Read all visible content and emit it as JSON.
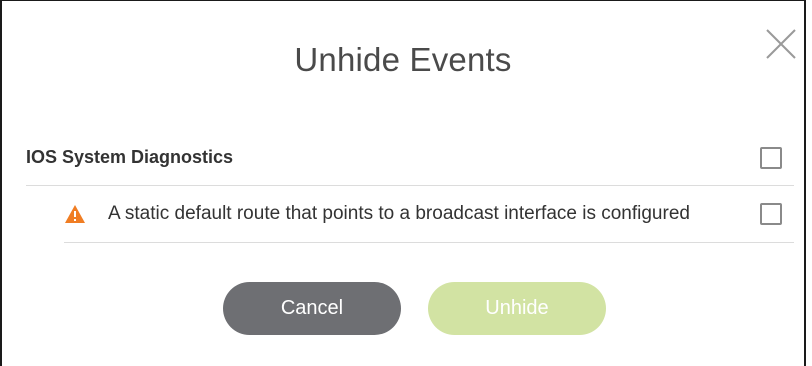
{
  "dialog": {
    "title": "Unhide Events",
    "close_icon": "close-icon"
  },
  "section": {
    "title": "IOS System Diagnostics",
    "checked": false
  },
  "events": [
    {
      "icon": "warning-icon",
      "icon_color": "#f07d23",
      "text": "A static default route that points to a broadcast interface is configured",
      "checked": false
    }
  ],
  "buttons": {
    "cancel_label": "Cancel",
    "unhide_label": "Unhide",
    "unhide_disabled": true
  },
  "colors": {
    "cancel_bg": "#6e6f73",
    "unhide_bg_disabled": "#d2e3a3",
    "warning": "#f07d23"
  }
}
